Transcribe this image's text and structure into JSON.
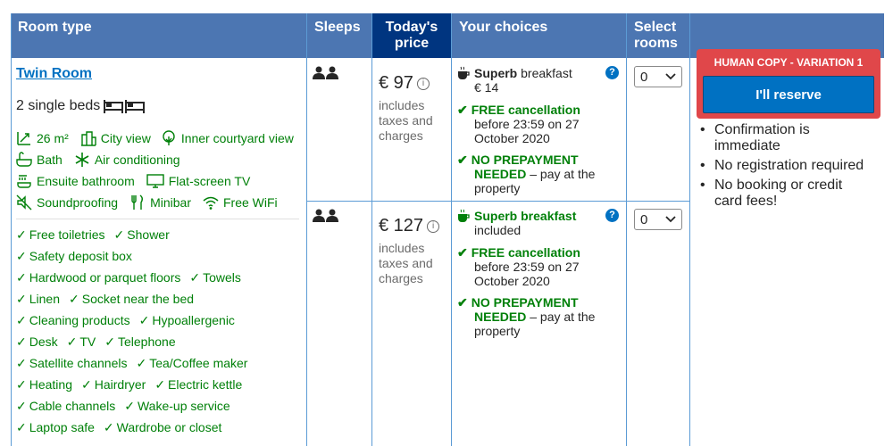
{
  "headers": {
    "room_type": "Room type",
    "sleeps": "Sleeps",
    "todays_price_line1": "Today's",
    "todays_price_line2": "price",
    "your_choices": "Your choices",
    "select_rooms_line1": "Select",
    "select_rooms_line2": "rooms"
  },
  "room": {
    "name": "Twin Room",
    "beds": "2 single beds",
    "facilities": {
      "size": "26 m²",
      "city_view": "City view",
      "courtyard_view": "Inner courtyard view",
      "bath": "Bath",
      "air_conditioning": "Air conditioning",
      "ensuite": "Ensuite bathroom",
      "tv": "Flat-screen TV",
      "soundproofing": "Soundproofing",
      "minibar": "Minibar",
      "wifi": "Free WiFi"
    },
    "amenity_rows": [
      [
        "Free toiletries",
        "Shower"
      ],
      [
        "Safety deposit box"
      ],
      [
        "Hardwood or parquet floors",
        "Towels"
      ],
      [
        "Linen",
        "Socket near the bed"
      ],
      [
        "Cleaning products",
        "Hypoallergenic"
      ],
      [
        "Desk",
        "TV",
        "Telephone"
      ],
      [
        "Satellite channels",
        "Tea/Coffee maker"
      ],
      [
        "Heating",
        "Hairdryer",
        "Electric kettle"
      ],
      [
        "Cable channels",
        "Wake-up service"
      ],
      [
        "Laptop safe",
        "Wardrobe or closet"
      ]
    ]
  },
  "options": [
    {
      "price": "€ 97",
      "tax_line1": "includes",
      "tax_line2": "taxes and",
      "tax_line3": "charges",
      "breakfast_strong": "Superb",
      "breakfast_rest": " breakfast",
      "breakfast_line2": "€ 14",
      "cancel_title": "FREE cancellation",
      "cancel_line1": "before 23:59 on 27",
      "cancel_line2": "October 2020",
      "prepay_title1": "NO PREPAYMENT",
      "prepay_title2": "NEEDED",
      "prepay_rest": " – pay at the",
      "prepay_line3": "property",
      "select_value": "0"
    },
    {
      "price": "€ 127",
      "tax_line1": "includes",
      "tax_line2": "taxes and",
      "tax_line3": "charges",
      "breakfast_strong": "Superb breakfast",
      "breakfast_rest": "",
      "breakfast_line2": "included",
      "cancel_title": "FREE cancellation",
      "cancel_line1": "before 23:59 on 27",
      "cancel_line2": "October 2020",
      "prepay_title1": "NO PREPAYMENT",
      "prepay_title2": "NEEDED",
      "prepay_rest": " – pay at the",
      "prepay_line3": "property",
      "select_value": "0"
    }
  ],
  "reserve": {
    "variation_label": "HUMAN COPY - VARIATION 1",
    "button_label": "I'll reserve",
    "bullets": [
      [
        "Confirmation is",
        "immediate"
      ],
      [
        "No registration required"
      ],
      [
        "No booking or credit",
        "card fees!"
      ]
    ]
  },
  "colors": {
    "header_bg": "#4c76b2",
    "price_header_bg": "#003580",
    "link_blue": "#0071c2",
    "green": "#008009",
    "variation_red": "#e0474a"
  }
}
